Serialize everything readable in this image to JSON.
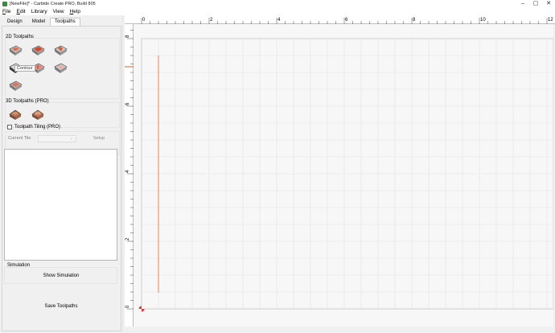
{
  "window": {
    "title": "[NewFile]* - Carbide Create PRO, Build 805",
    "minimize": "–",
    "maximize": "▢",
    "close": "✕"
  },
  "menu": {
    "items": [
      {
        "label": "File",
        "key": "F",
        "rest": "ile"
      },
      {
        "label": "Edit",
        "key": "E",
        "rest": "dit"
      },
      {
        "label": "Library",
        "key": "",
        "rest": "Library"
      },
      {
        "label": "View",
        "key": "",
        "rest": "View"
      },
      {
        "label": "Help",
        "key": "H",
        "rest": "elp"
      }
    ]
  },
  "tabs": [
    {
      "label": "Design",
      "active": false
    },
    {
      "label": "Model",
      "active": false
    },
    {
      "label": "Toolpaths",
      "active": true
    }
  ],
  "toolpaths_2d": {
    "title": "2D Toolpaths",
    "tools": [
      {
        "icon": "contour-toolpath-icon"
      },
      {
        "icon": "pocket-toolpath-icon"
      },
      {
        "icon": "vcarve-toolpath-icon"
      },
      {
        "icon": "drill-toolpath-icon"
      },
      {
        "icon": "texture-toolpath-icon"
      },
      {
        "icon": "advanced-vcarve-icon"
      },
      {
        "icon": "chamfer-toolpath-icon"
      }
    ],
    "tooltip": "Contour"
  },
  "toolpaths_3d": {
    "title": "3D Toolpaths (PRO)",
    "tools": [
      {
        "icon": "3d-rough-icon"
      },
      {
        "icon": "3d-finish-icon"
      }
    ]
  },
  "tiling": {
    "checkbox_label": "Toolpath Tiling (PRO)",
    "checked": false,
    "current_tile_label": "Current Tile",
    "setup_label": "Setup"
  },
  "simulation": {
    "title": "Simulation",
    "show_label": "Show Simulation"
  },
  "save_label": "Save Toolpaths",
  "ruler": {
    "x_ticks": [
      "0",
      "2",
      "4",
      "6",
      "8",
      "10",
      "12"
    ],
    "y_ticks": [
      "0",
      "2",
      "4",
      "6",
      "8"
    ]
  },
  "colors": {
    "accent": "#e05a2b",
    "grid_line": "#e2e2e2",
    "toolpath": "#e8834f"
  }
}
